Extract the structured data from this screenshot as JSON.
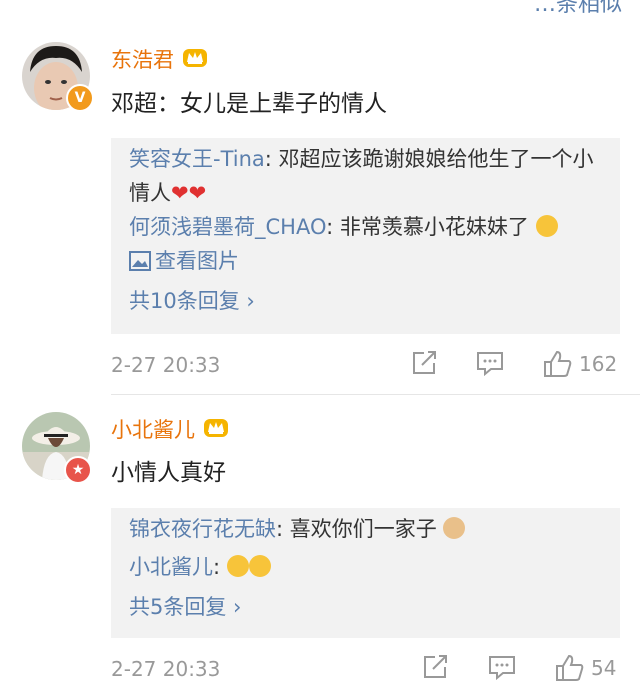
{
  "top_fragment": "…条相似",
  "comments": [
    {
      "username": "东浩君",
      "text": "邓超：女儿是上辈子的情人",
      "replies": [
        {
          "who": "笑容女王-Tina",
          "text": ": 邓超应该跪谢娘娘给他生了一个小情人"
        },
        {
          "who": "何须浅碧墨荷_CHAO",
          "text": ": 非常羡慕小花妹妹了"
        }
      ],
      "view_image_label": "查看图片",
      "more_replies_label": "共10条回复 ›",
      "date": "2-27 20:33",
      "likes": "162"
    },
    {
      "username": "小北酱儿",
      "text": "小情人真好",
      "replies": [
        {
          "who": "锦衣夜行花无缺",
          "text": ": 喜欢你们一家子"
        },
        {
          "who": "小北酱儿",
          "text": ":"
        }
      ],
      "more_replies_label": "共5条回复 ›",
      "date": "2-27 20:33",
      "likes": "54"
    }
  ],
  "colors": {
    "username": "#e8740c",
    "link": "#5b7fad",
    "meta": "#999999",
    "reply_bg": "#f2f2f2"
  },
  "icons": [
    "crown-icon",
    "verified-v-icon",
    "share-icon",
    "comment-icon",
    "like-icon",
    "image-icon",
    "heart-icon",
    "emoji-icon"
  ]
}
